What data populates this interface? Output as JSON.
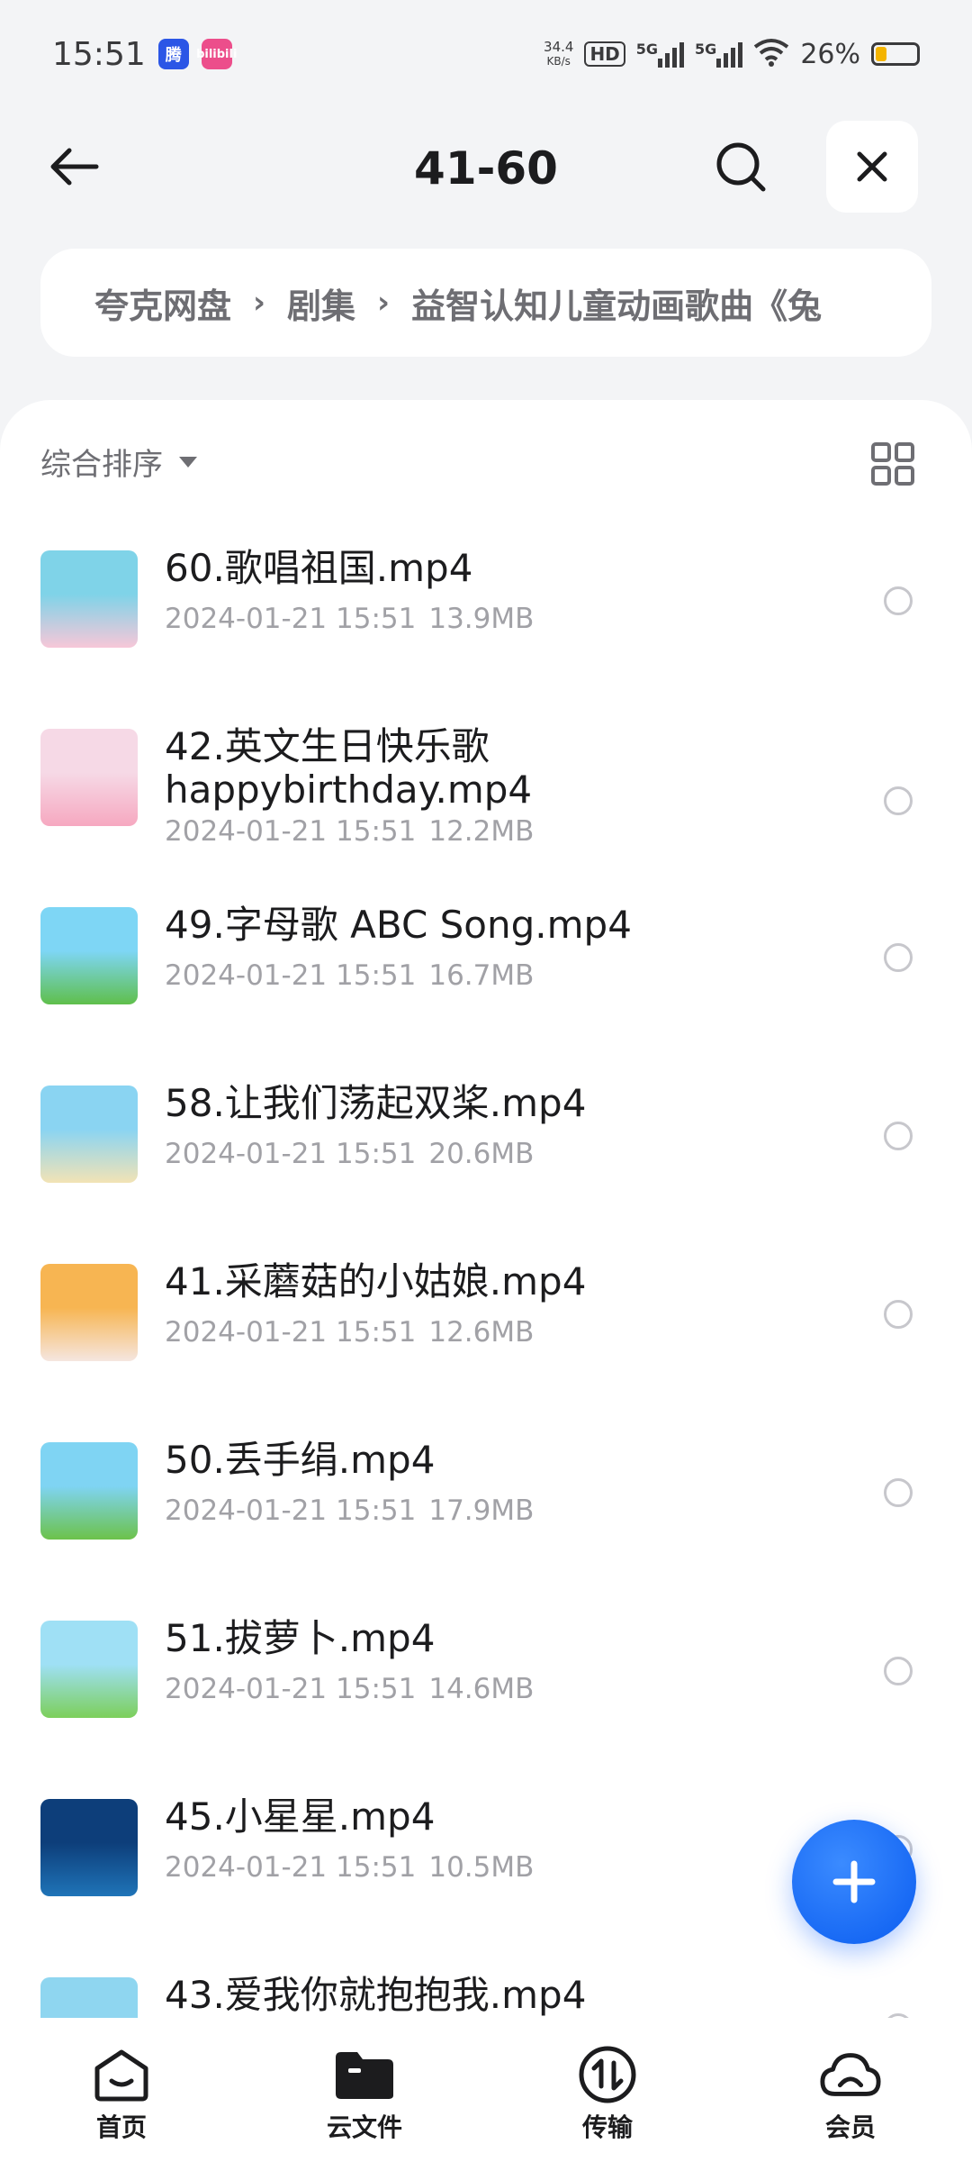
{
  "status_bar": {
    "time": "15:51",
    "net_speed_value": "34.4",
    "net_speed_unit": "KB/s",
    "hd_label": "HD",
    "sim1_label": "5G",
    "sim2_label": "5G",
    "battery_text": "26%",
    "battery_level": 0.26,
    "app_badge_1": "腾",
    "app_badge_2": "bilibili"
  },
  "header": {
    "title": "41-60",
    "back_icon": "arrow-left-icon",
    "search_icon": "search-icon",
    "close_icon": "close-icon"
  },
  "breadcrumb": {
    "items": [
      "夸克网盘",
      "剧集",
      "益智认知儿童动画歌曲《兔"
    ],
    "separator": "›"
  },
  "toolbar": {
    "sort_label": "综合排序",
    "view_icon": "grid-view-icon"
  },
  "files": [
    {
      "name": "60.歌唱祖国.mp4",
      "date": "2024-01-21 15:51",
      "size": "13.9MB",
      "thumb_colors": [
        "#7fd3e8",
        "#f7c7d8"
      ]
    },
    {
      "name": "42.英文生日快乐歌 happybirthday.mp4",
      "date": "2024-01-21 15:51",
      "size": "12.2MB",
      "thumb_colors": [
        "#f6d9e6",
        "#f6a8c0"
      ]
    },
    {
      "name": "49.字母歌 ABC Song.mp4",
      "date": "2024-01-21 15:51",
      "size": "16.7MB",
      "thumb_colors": [
        "#7ed6f5",
        "#5fbf4b"
      ]
    },
    {
      "name": "58.让我们荡起双桨.mp4",
      "date": "2024-01-21 15:51",
      "size": "20.6MB",
      "thumb_colors": [
        "#8ad4f2",
        "#f2e3b5"
      ]
    },
    {
      "name": "41.采蘑菇的小姑娘.mp4",
      "date": "2024-01-21 15:51",
      "size": "12.6MB",
      "thumb_colors": [
        "#f7b552",
        "#f5e6e0"
      ]
    },
    {
      "name": "50.丢手绢.mp4",
      "date": "2024-01-21 15:51",
      "size": "17.9MB",
      "thumb_colors": [
        "#7fd4f3",
        "#6cc24a"
      ]
    },
    {
      "name": "51.拔萝卜.mp4",
      "date": "2024-01-21 15:51",
      "size": "14.6MB",
      "thumb_colors": [
        "#9fe0f5",
        "#7ccf5a"
      ]
    },
    {
      "name": "45.小星星.mp4",
      "date": "2024-01-21 15:51",
      "size": "10.5MB",
      "thumb_colors": [
        "#0d3e7a",
        "#1f74b8"
      ]
    },
    {
      "name": "43.爱我你就抱抱我.mp4",
      "date": "",
      "size": "",
      "thumb_colors": [
        "#8fd6f0",
        "#6fc35a"
      ]
    }
  ],
  "fab": {
    "icon": "plus-icon",
    "color": "#0a5cf0"
  },
  "bottom_nav": [
    {
      "label": "首页",
      "icon": "home-icon"
    },
    {
      "label": "云文件",
      "icon": "folder-icon"
    },
    {
      "label": "传输",
      "icon": "transfer-icon"
    },
    {
      "label": "会员",
      "icon": "cloud-icon"
    }
  ]
}
